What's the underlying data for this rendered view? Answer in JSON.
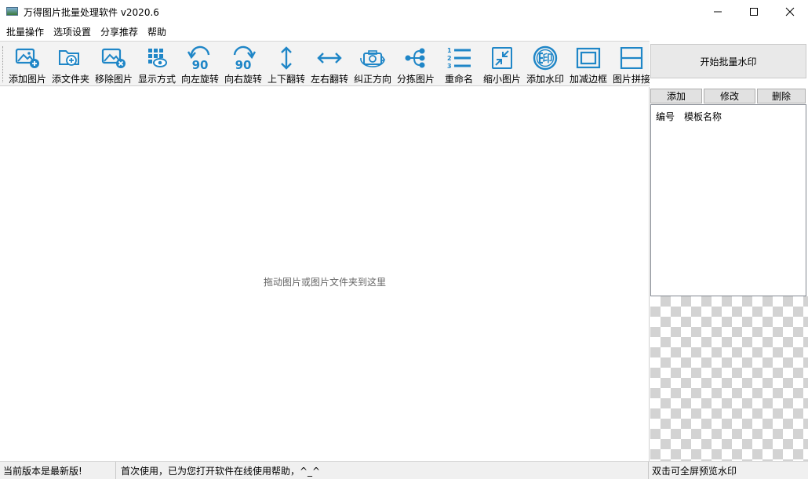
{
  "window": {
    "title": "万得图片批量处理软件 v2020.6",
    "controls": {
      "minimize": "minimize-icon",
      "maximize": "maximize-icon",
      "close": "close-icon"
    }
  },
  "menu": [
    "批量操作",
    "选项设置",
    "分享推荐",
    "帮助"
  ],
  "toolbar": {
    "accent_color": "#1f86c7",
    "items": [
      {
        "label": "添加图片",
        "icon": "add-image-icon"
      },
      {
        "label": "添文件夹",
        "icon": "add-folder-icon"
      },
      {
        "label": "移除图片",
        "icon": "remove-image-icon"
      },
      {
        "label": "显示方式",
        "icon": "view-mode-icon"
      },
      {
        "label": "向左旋转",
        "icon": "rotate-left-icon",
        "icon_text": "90"
      },
      {
        "label": "向右旋转",
        "icon": "rotate-right-icon",
        "icon_text": "90"
      },
      {
        "label": "上下翻转",
        "icon": "flip-vertical-icon"
      },
      {
        "label": "左右翻转",
        "icon": "flip-horizontal-icon"
      },
      {
        "label": "纠正方向",
        "icon": "correct-orientation-icon"
      },
      {
        "label": "分拣图片",
        "icon": "sort-images-icon"
      },
      {
        "label": "重命名",
        "icon": "rename-icon"
      },
      {
        "label": "缩小图片",
        "icon": "shrink-image-icon"
      },
      {
        "label": "添加水印",
        "icon": "watermark-icon",
        "icon_text": "印"
      },
      {
        "label": "加减边框",
        "icon": "border-icon"
      },
      {
        "label": "图片拼接",
        "icon": "stitch-icon"
      }
    ]
  },
  "right_panel": {
    "start_button": "开始批量水印",
    "template_buttons": [
      "添加",
      "修改",
      "删除"
    ],
    "template_columns": [
      "编号",
      "模板名称"
    ]
  },
  "main": {
    "drop_hint": "拖动图片或图片文件夹到这里"
  },
  "status": {
    "version": "当前版本是最新版!",
    "message": "首次使用，已为您打开软件在线使用帮助，^_^",
    "preview_tip": "双击可全屏预览水印"
  }
}
